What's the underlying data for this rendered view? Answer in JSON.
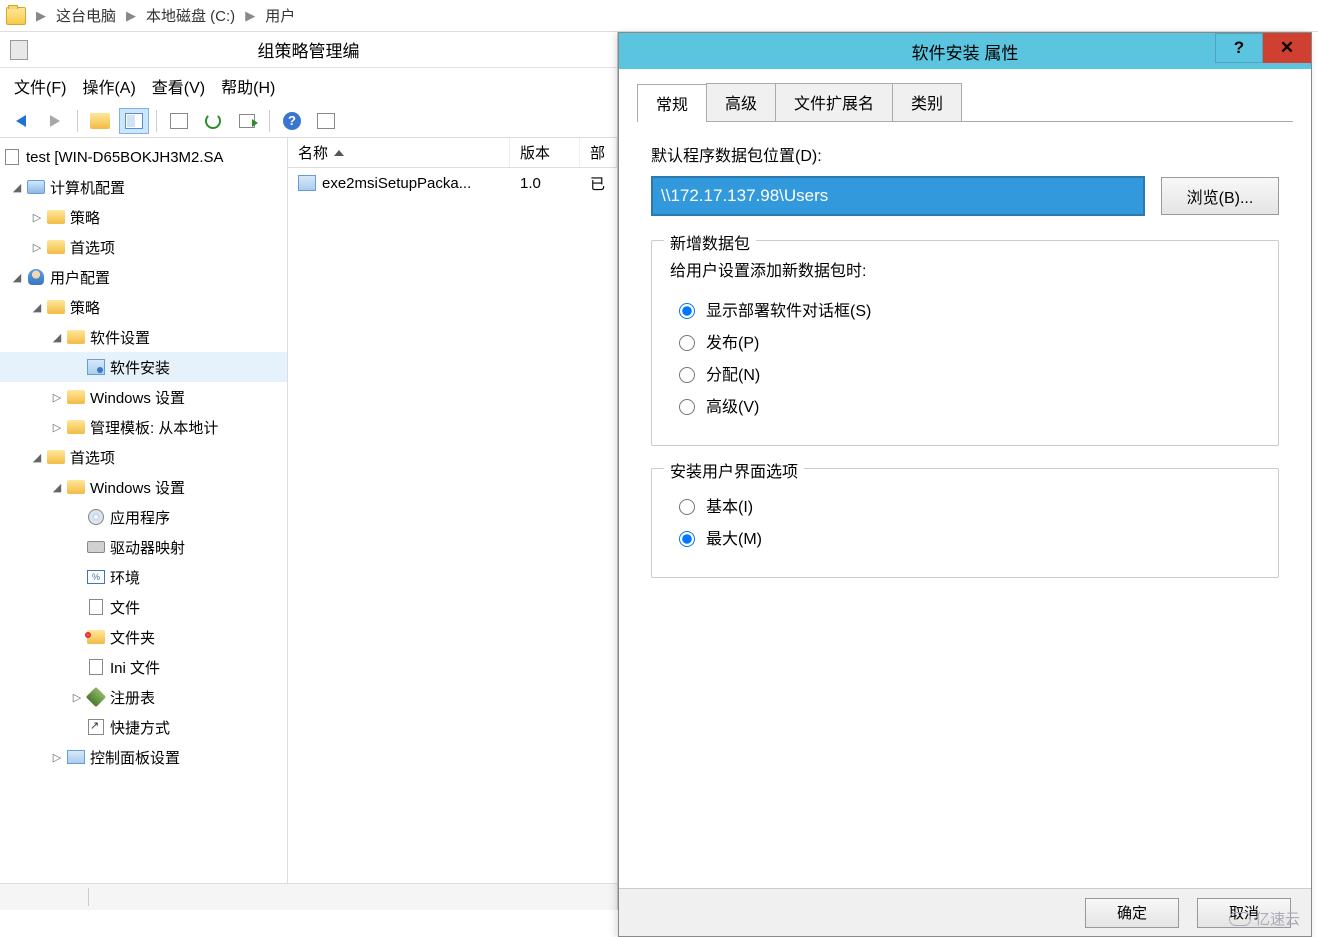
{
  "breadcrumb": {
    "items": [
      "这台电脑",
      "本地磁盘 (C:)",
      "用户"
    ]
  },
  "gpedit": {
    "title": "组策略管理编",
    "menu": {
      "file": "文件(F)",
      "action": "操作(A)",
      "view": "查看(V)",
      "help": "帮助(H)"
    },
    "tree": {
      "root": "test [WIN-D65BOKJH3M2.SA",
      "computer_config": "计算机配置",
      "policy": "策略",
      "preferences": "首选项",
      "user_config": "用户配置",
      "software_settings": "软件设置",
      "software_install": "软件安装",
      "windows_settings": "Windows 设置",
      "admin_templates": "管理模板: 从本地计",
      "apps": "应用程序",
      "drive_maps": "驱动器映射",
      "env": "环境",
      "files": "文件",
      "folders": "文件夹",
      "ini": "Ini 文件",
      "registry": "注册表",
      "shortcuts": "快捷方式",
      "control_panel": "控制面板设置"
    },
    "list": {
      "cols": {
        "name": "名称",
        "version": "版本",
        "deploy": "部"
      },
      "rows": [
        {
          "name": "exe2msiSetupPacka...",
          "version": "1.0",
          "deploy": "已"
        }
      ]
    }
  },
  "dialog": {
    "title": "软件安装 属性",
    "help": "?",
    "close": "✕",
    "tabs": {
      "general": "常规",
      "advanced": "高级",
      "file_ext": "文件扩展名",
      "category": "类别"
    },
    "default_pkg_label": "默认程序数据包位置(D):",
    "path_value": "\\\\172.17.137.98\\Users",
    "browse": "浏览(B)...",
    "new_pkg": {
      "title": "新增数据包",
      "desc": "给用户设置添加新数据包时:",
      "opt_show": "显示部署软件对话框(S)",
      "opt_publish": "发布(P)",
      "opt_assign": "分配(N)",
      "opt_advanced": "高级(V)"
    },
    "ui_opts": {
      "title": "安装用户界面选项",
      "basic": "基本(I)",
      "max": "最大(M)"
    },
    "ok": "确定",
    "cancel": "取消"
  },
  "watermark": "亿速云"
}
